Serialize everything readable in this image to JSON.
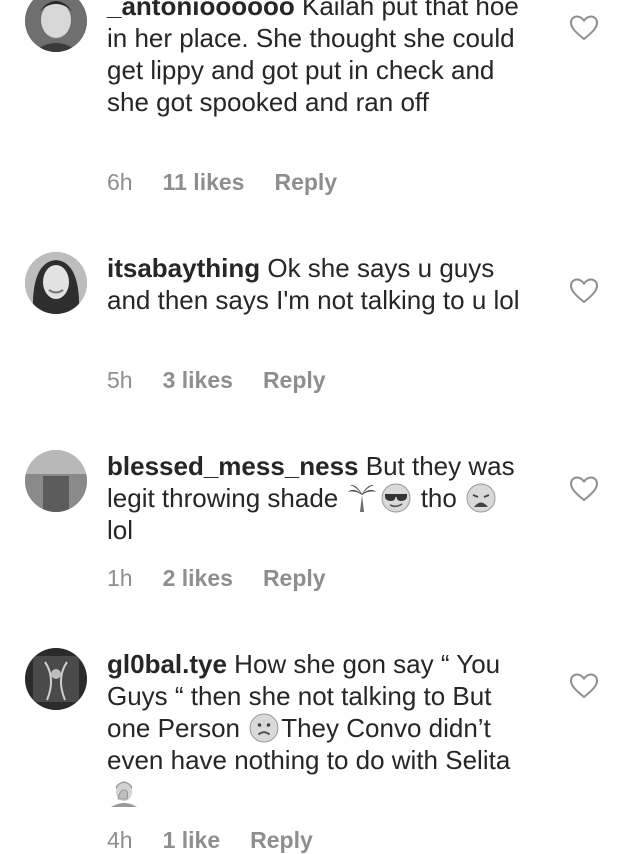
{
  "comments": [
    {
      "username": "_antonioooooo",
      "text": " Kailah put that hoe in her place. She thought she could get lippy and got put in check and she got spooked and ran off",
      "time": "6h",
      "likes": "11 likes",
      "reply": "Reply"
    },
    {
      "username": "itsabaything",
      "text": " Ok she says u guys and then says I'm not talking to u lol",
      "time": "5h",
      "likes": "3 likes",
      "reply": "Reply"
    },
    {
      "username": "blessed_mess_ness",
      "text_a": " But they was legit throwing shade ",
      "text_b": " tho ",
      "text_c": " lol",
      "emojis": [
        "palm-tree-emoji",
        "sunglasses-emoji",
        "weary-face-emoji"
      ],
      "time": "1h",
      "likes": "2 likes",
      "reply": "Reply"
    },
    {
      "username": "gl0bal.tye",
      "text_a": " How she gon say “ You Guys “ then she not talking to But one Person ",
      "text_b": "They Convo didn’t even have nothing to do with Selita ",
      "emojis": [
        "slightly-frowning-face-emoji",
        "facepalm-emoji"
      ],
      "time": "4h",
      "likes": "1 like",
      "reply": "Reply"
    }
  ],
  "icons": {
    "like": "heart-outline-icon"
  },
  "colors": {
    "text": "#262626",
    "meta": "#8e8e8e"
  }
}
